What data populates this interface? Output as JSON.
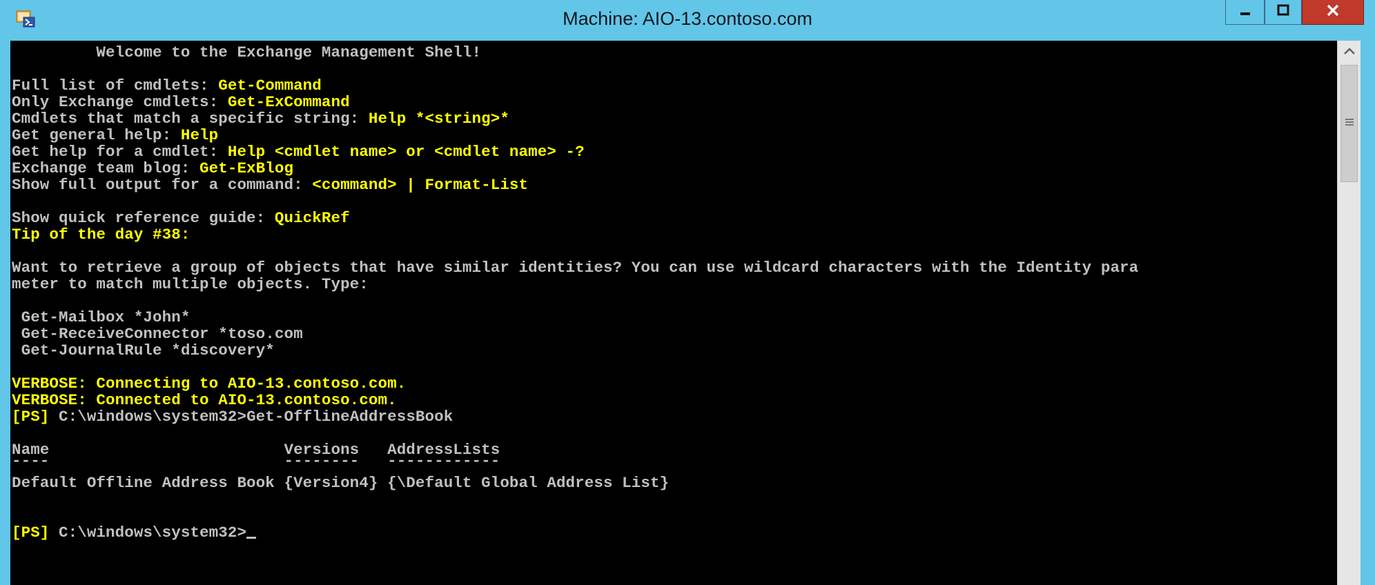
{
  "window": {
    "title": "Machine: AIO-13.contoso.com",
    "icon": "powershell-app-icon",
    "controls": [
      "minimize-icon",
      "maximize-icon",
      "close-icon"
    ]
  },
  "console": {
    "welcome": "         Welcome to the Exchange Management Shell!",
    "help_lines": [
      {
        "label": "Full list of cmdlets: ",
        "value": "Get-Command"
      },
      {
        "label": "Only Exchange cmdlets: ",
        "value": "Get-ExCommand"
      },
      {
        "label": "Cmdlets that match a specific string: ",
        "value": "Help *<string>*"
      },
      {
        "label": "Get general help: ",
        "value": "Help"
      },
      {
        "label": "Get help for a cmdlet: ",
        "value": "Help <cmdlet name> or <cmdlet name> -?"
      },
      {
        "label": "Exchange team blog: ",
        "value": "Get-ExBlog"
      },
      {
        "label": "Show full output for a command: ",
        "value": "<command> | Format-List"
      }
    ],
    "quickref": {
      "label": "Show quick reference guide: ",
      "value": "QuickRef"
    },
    "tip_title": "Tip of the day #38:",
    "tip_text_1": "Want to retrieve a group of objects that have similar identities? You can use wildcard characters with the Identity para",
    "tip_text_2": "meter to match multiple objects. Type:",
    "examples": [
      " Get-Mailbox *John*",
      " Get-ReceiveConnector *toso.com",
      " Get-JournalRule *discovery*"
    ],
    "verbose_1": "VERBOSE: Connecting to AIO-13.contoso.com.",
    "verbose_2": "VERBOSE: Connected to AIO-13.contoso.com.",
    "prompt_tag": "[PS]",
    "prompt_path": " C:\\windows\\system32>",
    "command": "Get-OfflineAddressBook",
    "table_header": "Name                         Versions   AddressLists",
    "table_rule": "----                         --------   ------------",
    "table_row": "Default Offline Address Book {Version4} {\\Default Global Address List}",
    "current_prompt_tag": "[PS]",
    "current_prompt_path": " C:\\windows\\system32>"
  },
  "colors": {
    "titlebar": "#62c6e8",
    "console_bg": "#000000",
    "text_gray": "#c0c0c0",
    "text_yellow": "#ffff00",
    "close_button": "#c0392b"
  }
}
